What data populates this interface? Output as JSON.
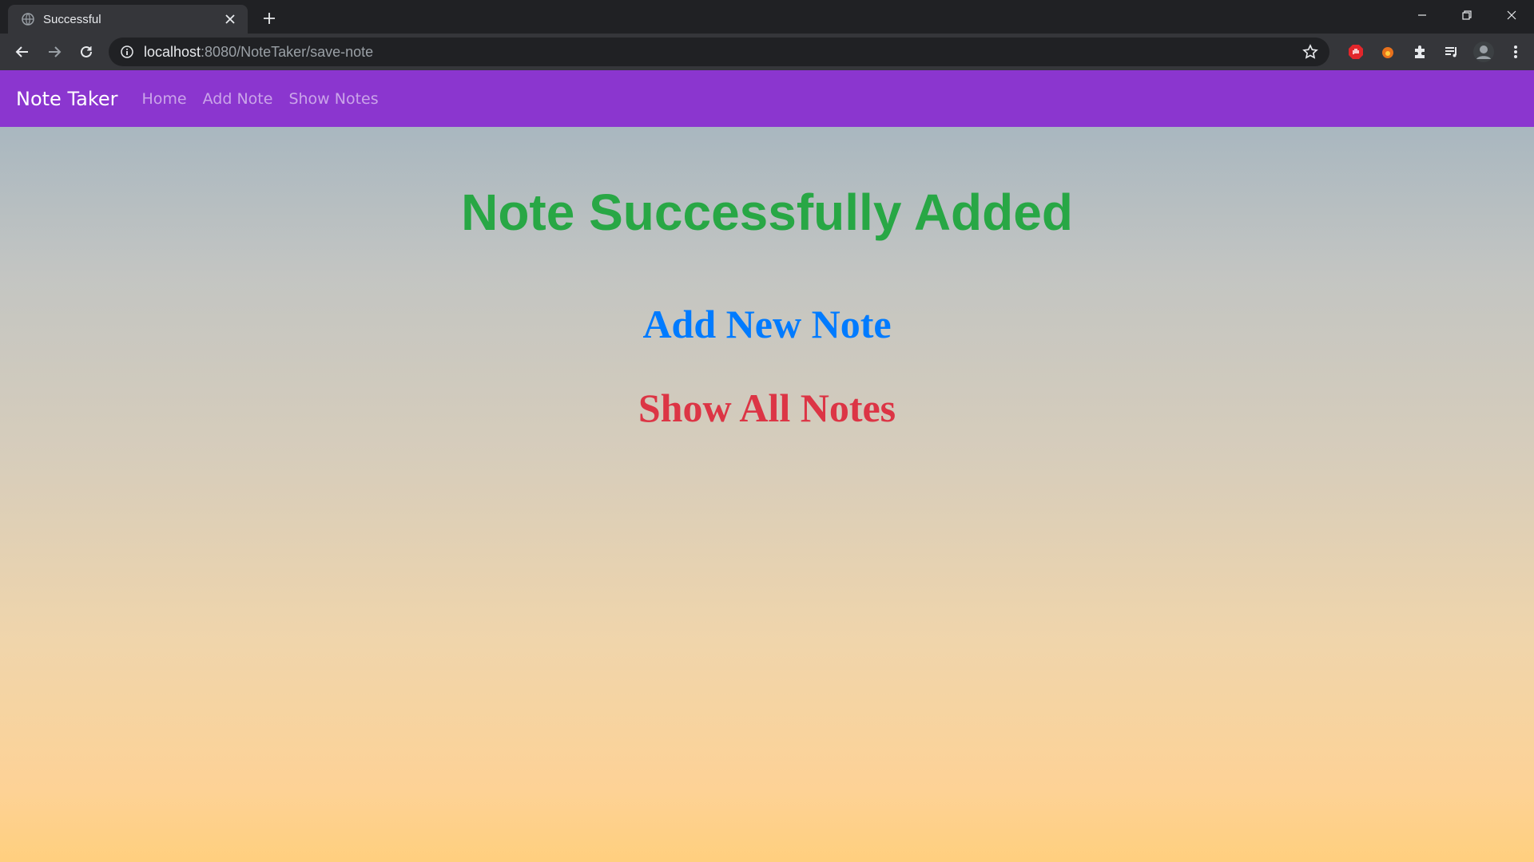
{
  "browser": {
    "tab": {
      "title": "Successful",
      "close_icon": "close-icon"
    },
    "url": {
      "host": "localhost",
      "rest": ":8080/NoteTaker/save-note"
    }
  },
  "navbar": {
    "brand": "Note Taker",
    "links": [
      "Home",
      "Add Note",
      "Show Notes"
    ],
    "background": "#8b36cf"
  },
  "main": {
    "heading": "Note Successfully Added",
    "heading_color": "#28a745",
    "add_link": "Add New Note",
    "add_link_color": "#007bff",
    "show_link": "Show All Notes",
    "show_link_color": "#dc3545"
  }
}
